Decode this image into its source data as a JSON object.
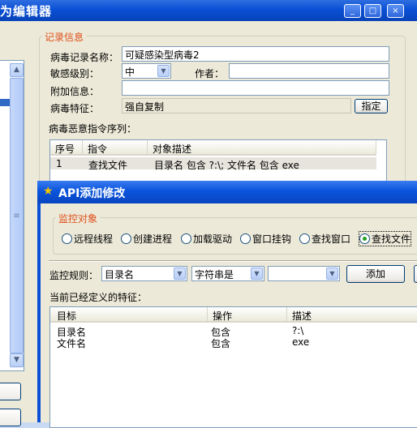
{
  "back_window": {
    "title": "为编辑器",
    "controls": [
      "_",
      "□",
      "×"
    ],
    "record_group": {
      "legend": "记录信息",
      "virus_name_label": "病毒记录名称：",
      "virus_name_value": "可疑感染型病毒2",
      "sensitivity_label": "敏感级别：",
      "sensitivity_value": "中",
      "author_label": "作者：",
      "author_value": "",
      "extra_label": "附加信息：",
      "extra_value": "",
      "feature_label": "病毒特征：",
      "feature_value": "强自复制",
      "specify_button": "指定",
      "sequence_label": "病毒恶意指令序列：",
      "columns": [
        "序号",
        "指令",
        "对象描述"
      ],
      "rows": [
        {
          "no": "1",
          "cmd": "查找文件",
          "desc": "目录名 包含 ?:\\; 文件名 包含 exe"
        }
      ]
    }
  },
  "dialog": {
    "title": "API添加修改",
    "monitor_legend": "监控对象",
    "options": [
      {
        "label": "远程线程",
        "selected": false
      },
      {
        "label": "创建进程",
        "selected": false
      },
      {
        "label": "加载驱动",
        "selected": false
      },
      {
        "label": "窗口挂钩",
        "selected": false
      },
      {
        "label": "查找窗口",
        "selected": false
      },
      {
        "label": "查找文件",
        "selected": true
      }
    ],
    "rule_label": "监控规则：",
    "rule_field": "目录名",
    "rule_op": "字符串是",
    "rule_value": "",
    "add_button": "添加",
    "defined_label": "当前已经定义的特征：",
    "columns": [
      "目标",
      "操作",
      "描述"
    ],
    "rows": [
      {
        "target": "目录名",
        "op": "包含",
        "desc": "?:\\"
      },
      {
        "target": "文件名",
        "op": "包含",
        "desc": "exe"
      }
    ]
  },
  "colors": {
    "accent": "#0a4fd6",
    "legend": "#e0501c",
    "face": "#ece9d8"
  }
}
